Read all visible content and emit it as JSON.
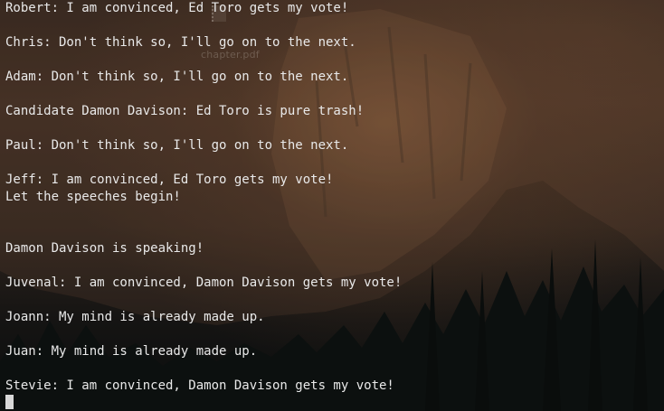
{
  "background": {
    "ghost_file_label": "chapter.pdf",
    "ghost_file_icon": "pdf-file-icon"
  },
  "terminal": {
    "lines": [
      "Robert: I am convinced, Ed Toro gets my vote!",
      "",
      "Chris: Don't think so, I'll go on to the next.",
      "",
      "Adam: Don't think so, I'll go on to the next.",
      "",
      "Candidate Damon Davison: Ed Toro is pure trash!",
      "",
      "Paul: Don't think so, I'll go on to the next.",
      "",
      "Jeff: I am convinced, Ed Toro gets my vote!",
      "Let the speeches begin!",
      "",
      "",
      "Damon Davison is speaking!",
      "",
      "Juvenal: I am convinced, Damon Davison gets my vote!",
      "",
      "Joann: My mind is already made up.",
      "",
      "Juan: My mind is already made up.",
      "",
      "Stevie: I am convinced, Damon Davison gets my vote!"
    ],
    "cursor_icon": "block-cursor"
  }
}
